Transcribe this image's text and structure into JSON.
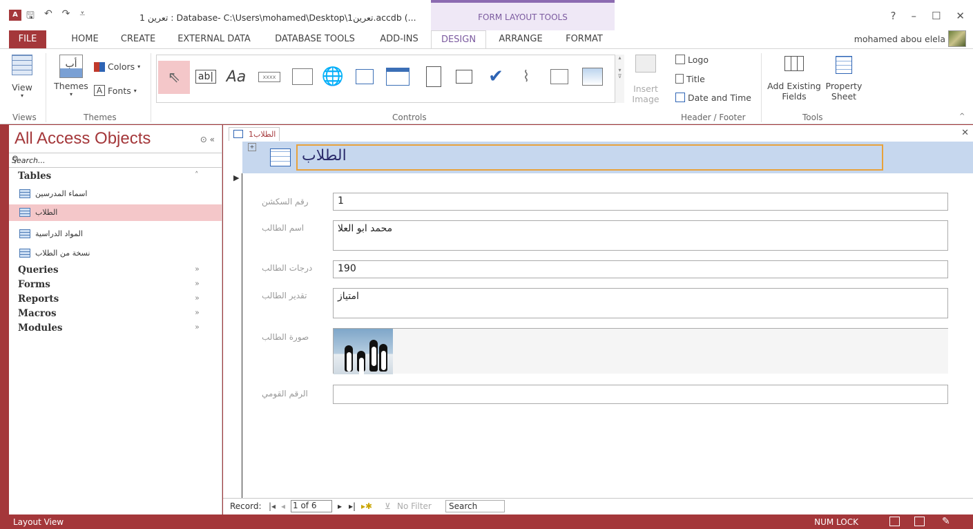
{
  "window": {
    "title": "تعرين 1 : Database- C:\\Users\\mohamed\\Desktop\\تعرين1.accdb (...",
    "contextual_tab_group": "FORM LAYOUT TOOLS",
    "help": "?",
    "minimize": "–",
    "maximize": "☐",
    "close": "✕"
  },
  "ribbon_tabs": {
    "file": "FILE",
    "home": "HOME",
    "create": "CREATE",
    "external": "EXTERNAL DATA",
    "dbtools": "DATABASE TOOLS",
    "addins": "ADD-INS",
    "design": "DESIGN",
    "arrange": "ARRANGE",
    "format": "FORMAT",
    "user": "mohamed abou elela"
  },
  "ribbon": {
    "view": "View",
    "themes": "Themes",
    "colors": "Colors",
    "fonts": "Fonts",
    "insert_image_1": "Insert",
    "insert_image_2": "Image",
    "logo": "Logo",
    "title": "Title",
    "date_time": "Date and Time",
    "add_existing_1": "Add Existing",
    "add_existing_2": "Fields",
    "property_1": "Property",
    "property_2": "Sheet",
    "groups": {
      "views": "Views",
      "themes": "Themes",
      "controls": "Controls",
      "header_footer": "Header / Footer",
      "tools": "Tools"
    }
  },
  "nav": {
    "title": "All Access Objects",
    "search_placeholder": "Search...",
    "tables_header": "Tables",
    "tables": [
      "اسماء المدرسين",
      "الطلاب",
      "المواد الدراسية",
      "نسخة من الطلاب"
    ],
    "sections": [
      "Queries",
      "Forms",
      "Reports",
      "Macros",
      "Modules"
    ]
  },
  "document": {
    "tab_label": "الطلاب1",
    "form_title": "الطلاب",
    "fields": [
      {
        "label": "رقم السكشن",
        "value": "1"
      },
      {
        "label": "اسم الطالب",
        "value": "محمد ابو العلا"
      },
      {
        "label": "درجات الطالب",
        "value": "190"
      },
      {
        "label": "تقدير الطالب",
        "value": "امتياز"
      },
      {
        "label": "صورة الطالب",
        "value": ""
      },
      {
        "label": "الرقم القومي",
        "value": ""
      }
    ]
  },
  "record_nav": {
    "label": "Record:",
    "position": "1 of 6",
    "filter": "No Filter",
    "search": "Search"
  },
  "status": {
    "mode": "Layout View",
    "numlock": "NUM LOCK"
  },
  "colors": {
    "accent": "#a4373a",
    "selection": "#f4c7c9",
    "form_header": "#c6d7ee",
    "contextual": "#7b5a9f"
  }
}
